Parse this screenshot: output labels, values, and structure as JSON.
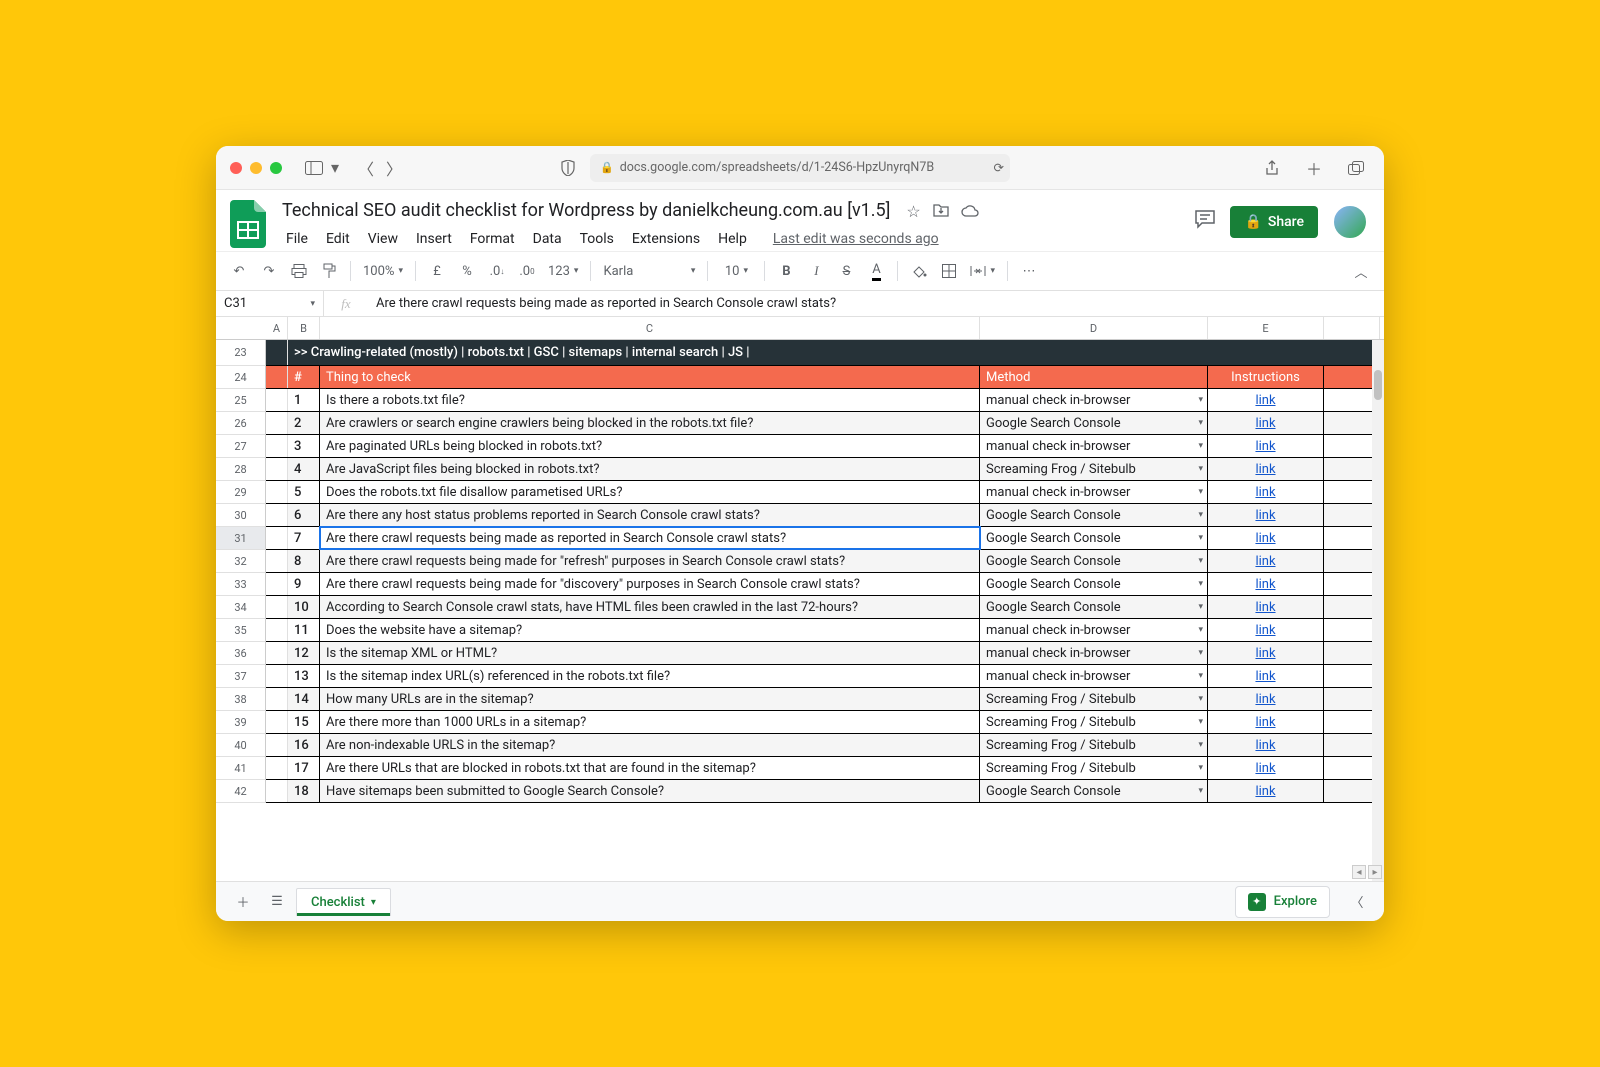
{
  "browser": {
    "url": "docs.google.com/spreadsheets/d/1-24S6-HpzUnyrqN7B"
  },
  "doc": {
    "title": "Technical SEO audit checklist for Wordpress by danielkcheung.com.au [v1.5]",
    "last_edit": "Last edit was seconds ago"
  },
  "menus": [
    "File",
    "Edit",
    "View",
    "Insert",
    "Format",
    "Data",
    "Tools",
    "Extensions",
    "Help"
  ],
  "share": "Share",
  "toolbar": {
    "zoom": "100%",
    "font": "Karla",
    "size": "10",
    "numfmt": "123"
  },
  "namebox": "C31",
  "formula": "Are there crawl requests being made as reported in Search Console crawl stats?",
  "columns": [
    "A",
    "B",
    "C",
    "D",
    "E"
  ],
  "section_label": ">> Crawling-related (mostly)  |  robots.txt  |  GSC  |  sitemaps  |  internal search  |  JS  |",
  "header_row": {
    "num": "#",
    "thing": "Thing to check",
    "method": "Method",
    "instr": "Instructions"
  },
  "link_text": "link",
  "start_rownum": 23,
  "selected_rownum": 31,
  "rows": [
    {
      "n": "1",
      "c": "Is there a robots.txt file?",
      "d": "manual check in-browser"
    },
    {
      "n": "2",
      "c": "Are crawlers or search engine crawlers being blocked in the robots.txt file?",
      "d": "Google Search Console"
    },
    {
      "n": "3",
      "c": "Are paginated URLs being blocked in robots.txt?",
      "d": "manual check in-browser"
    },
    {
      "n": "4",
      "c": "Are JavaScript files being blocked in robots.txt?",
      "d": "Screaming Frog / Sitebulb"
    },
    {
      "n": "5",
      "c": "Does the robots.txt file disallow parametised URLs?",
      "d": "manual check in-browser"
    },
    {
      "n": "6",
      "c": "Are there any host status problems reported in Search Console crawl stats?",
      "d": "Google Search Console"
    },
    {
      "n": "7",
      "c": "Are there crawl requests being made as reported in Search Console crawl stats?",
      "d": "Google Search Console"
    },
    {
      "n": "8",
      "c": "Are there crawl requests being made for \"refresh\" purposes in Search Console crawl stats?",
      "d": "Google Search Console"
    },
    {
      "n": "9",
      "c": "Are there crawl requests being made for \"discovery\" purposes in Search Console crawl stats?",
      "d": "Google Search Console"
    },
    {
      "n": "10",
      "c": "According to Search Console crawl stats, have HTML files been crawled in the last 72-hours?",
      "d": "Google Search Console"
    },
    {
      "n": "11",
      "c": "Does the website have a sitemap?",
      "d": "manual check in-browser"
    },
    {
      "n": "12",
      "c": "Is the sitemap XML or HTML?",
      "d": "manual check in-browser"
    },
    {
      "n": "13",
      "c": "Is the sitemap index URL(s) referenced in the robots.txt file?",
      "d": "manual check in-browser"
    },
    {
      "n": "14",
      "c": "How many URLs are in the sitemap?",
      "d": "Screaming Frog / Sitebulb"
    },
    {
      "n": "15",
      "c": "Are there more than 1000 URLs in a sitemap?",
      "d": "Screaming Frog / Sitebulb"
    },
    {
      "n": "16",
      "c": "Are non-indexable URLS in the sitemap?",
      "d": "Screaming Frog / Sitebulb"
    },
    {
      "n": "17",
      "c": "Are there URLs that are blocked in robots.txt that are found in the sitemap?",
      "d": "Screaming Frog / Sitebulb"
    },
    {
      "n": "18",
      "c": "Have sitemaps been submitted to Google Search Console?",
      "d": "Google Search Console"
    }
  ],
  "tab_name": "Checklist",
  "explore": "Explore"
}
